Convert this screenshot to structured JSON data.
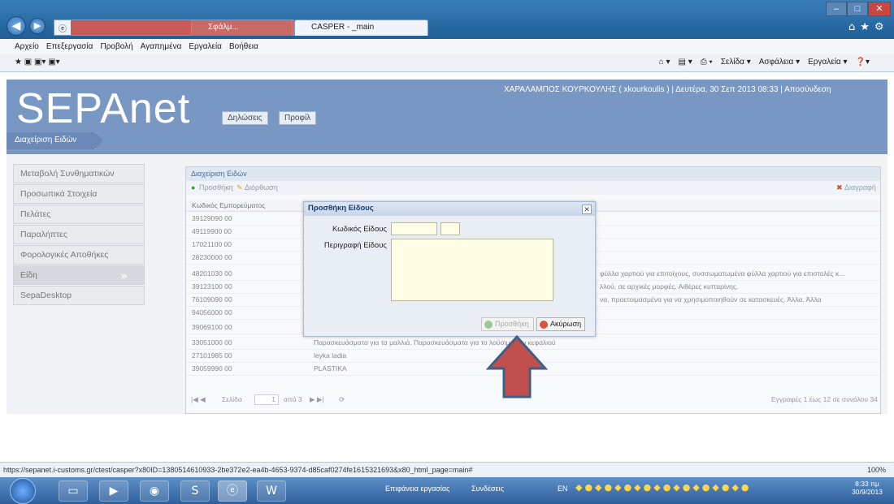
{
  "browser": {
    "address_host": "i-customs.gr",
    "tab1_label": "Σφάλμ...",
    "tab2_label": "CASPER - _main",
    "menu": [
      "Αρχείο",
      "Επεξεργασία",
      "Προβολή",
      "Αγαπημένα",
      "Εργαλεία",
      "Βοήθεια"
    ],
    "command_bar": [
      "Σελίδα ▾",
      "Ασφάλεια ▾",
      "Εργαλεία ▾"
    ],
    "status_url": "https://sepanet.i-customs.gr/ctest/casper?x80ID=1380514610933-2be372e2-ea4b-4653-9374-d85caf0274fe1615321693&x80_html_page=main#",
    "zoom": "100%"
  },
  "app": {
    "logo": "SEPAnet",
    "header_buttons": [
      "Δηλώσεις",
      "Προφίλ"
    ],
    "user_info": "ΧΑΡΑΛΑΜΠΟΣ ΚΟΥΡΚΟΥΛΗΣ ( xkourkoulis ) | Δευτέρα, 30 Σεπ 2013 08:33 | Αποσύνδεση",
    "breadcrumb": "Διαχείριση Ειδών"
  },
  "sidebar": {
    "items": [
      {
        "label": "Μεταβολή Συνθηματικών"
      },
      {
        "label": "Προσωπικά Στοιχεία"
      },
      {
        "label": "Πελάτες"
      },
      {
        "label": "Παραλήπτες"
      },
      {
        "label": "Φορολογικές Αποθήκες"
      },
      {
        "label": "Είδη"
      },
      {
        "label": "SepaDesktop"
      }
    ]
  },
  "grid": {
    "title": "Διαχείριση Ειδών",
    "toolbar_add": "Προσθήκη",
    "toolbar_edit": "Διόρθωση",
    "toolbar_delete": "Διαγραφή",
    "column_code": "Κωδικός Εμπορεύματος",
    "rows": [
      {
        "code": "39129090 00",
        "desc": ""
      },
      {
        "code": "49119900 00",
        "desc": ""
      },
      {
        "code": "17021100 00",
        "desc": ""
      },
      {
        "code": "28230000 00",
        "desc": ""
      },
      {
        "code": "48201030 00",
        "desc": "φύλλα χαρτιού για επιτοίχους, συσσωματωμένα φύλλα χαρτιού για επιστολές κ..."
      },
      {
        "code": "39123100 00",
        "desc": "λλού, σε αρχικές μορφές. Αιθέρες κυτταρίνης."
      },
      {
        "code": "76109090 00",
        "desc": "να, προετοιμασμένα για να χρησιμοποιηθούν σε κατασκευές. Άλλα. Άλλα"
      },
      {
        "code": "94056000 00",
        "desc": ""
      },
      {
        "code": "39069100 00",
        "desc": ""
      },
      {
        "code": "33051000 00",
        "desc": "Παρασκευάσματα για τα μαλλιά. Παρασκευάσματα για το λούσιμο του κεφαλιού"
      },
      {
        "code": "27101985 00",
        "desc": "leyka ladia"
      },
      {
        "code": "39059990 00",
        "desc": "PLASTIKA"
      }
    ],
    "pager_page_label": "Σελίδα",
    "pager_page": "1",
    "pager_of": "από 3",
    "pager_info": "Εγγραφές 1 έως 12 σε συνόλου 34"
  },
  "modal": {
    "title": "Προσθήκη Είδους",
    "code_label": "Κωδικός Είδους",
    "desc_label": "Περιγραφή Είδους",
    "add_button": "Προσθήκη",
    "cancel_button": "Ακύρωση"
  },
  "taskbar": {
    "desktop_label": "Επιφάνεια εργασίας",
    "connections_label": "Συνδέσεις",
    "lang": "EN",
    "time": "8:33 πμ",
    "date": "30/9/2013"
  },
  "colors": {
    "header": "#7897c2",
    "arrow": "#c0504d"
  }
}
